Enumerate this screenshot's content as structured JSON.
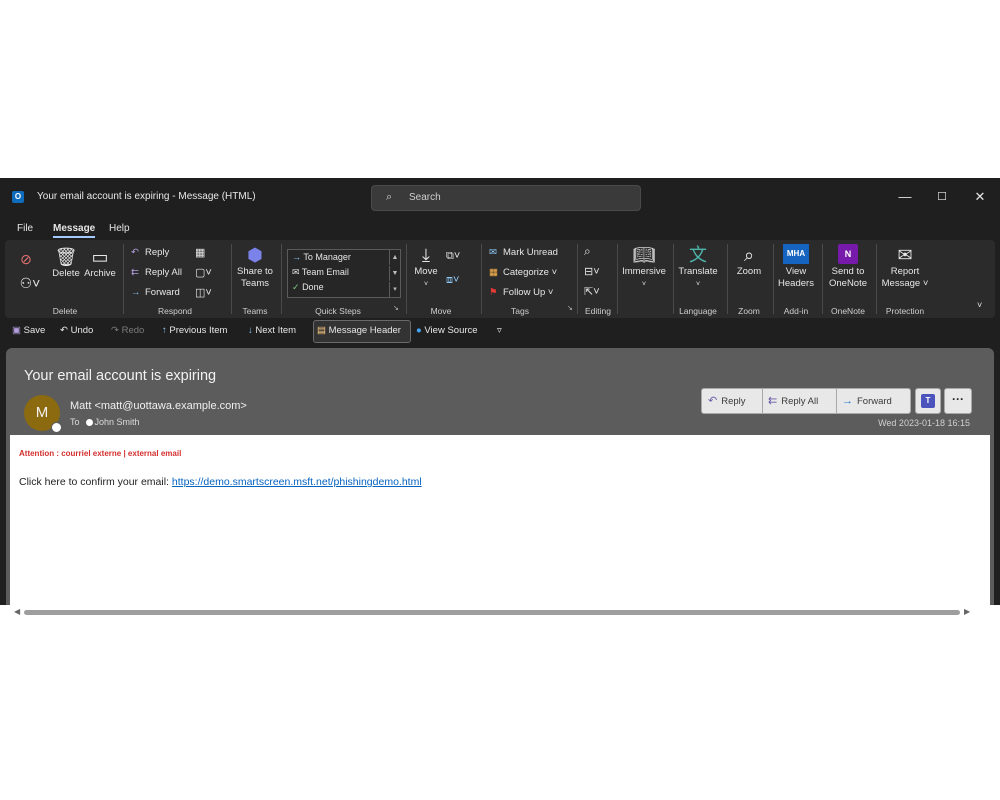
{
  "window": {
    "title": "Your email account is expiring  -  Message (HTML)",
    "app_icon": "O",
    "search_placeholder": "Search",
    "controls": [
      "—",
      "☐",
      "✕"
    ]
  },
  "menu": {
    "file": "File",
    "message": "Message",
    "help": "Help"
  },
  "ribbon": {
    "delete_group": {
      "delete": "Delete",
      "archive": "Archive",
      "label": "Delete"
    },
    "respond_group": {
      "reply": "Reply",
      "reply_all": "Reply All",
      "forward": "Forward",
      "label": "Respond"
    },
    "teams_group": {
      "share": "Share to",
      "share2": "Teams",
      "label": "Teams"
    },
    "quicksteps_group": {
      "items": [
        "To Manager",
        "Team Email",
        "Done"
      ],
      "label": "Quick Steps"
    },
    "move_group": {
      "move": "Move",
      "label": "Move"
    },
    "tags_group": {
      "mark_unread": "Mark Unread",
      "categorize": "Categorize",
      "follow_up": "Follow Up",
      "label": "Tags"
    },
    "editing_group": {
      "label": "Editing"
    },
    "immersive": {
      "btn": "Immersive"
    },
    "language_group": {
      "translate": "Translate",
      "label": "Language"
    },
    "zoom_group": {
      "zoom": "Zoom",
      "label": "Zoom"
    },
    "addin_group": {
      "mha": "MHA",
      "view": "View",
      "headers": "Headers",
      "label": "Add-in"
    },
    "onenote_group": {
      "send": "Send to",
      "onenote": "OneNote",
      "label": "OneNote"
    },
    "protection_group": {
      "report": "Report",
      "message": "Message",
      "label": "Protection"
    }
  },
  "qat": {
    "save": "Save",
    "undo": "Undo",
    "redo": "Redo",
    "previous": "Previous Item",
    "next": "Next Item",
    "message_header": "Message Header",
    "view_source": "View Source"
  },
  "email": {
    "subject": "Your email account is expiring",
    "avatar_initial": "M",
    "sender": "Matt <matt@uottawa.example.com>",
    "to_label": "To",
    "recipient": "John Smith",
    "date": "Wed 2023-01-18 16:15",
    "actions": {
      "reply": "Reply",
      "reply_all": "Reply All",
      "forward": "Forward"
    },
    "warning": "Attention : courriel externe | external email",
    "body_text": "Click here to confirm your email: ",
    "link": "https://demo.smartscreen.msft.net/phishingdemo.html"
  },
  "colors": {
    "accent": "#0f6cbd",
    "warning_red": "#d32f2f",
    "link": "#0563c1",
    "teams": "#4b53bc",
    "avatar": "#8b6a10"
  }
}
